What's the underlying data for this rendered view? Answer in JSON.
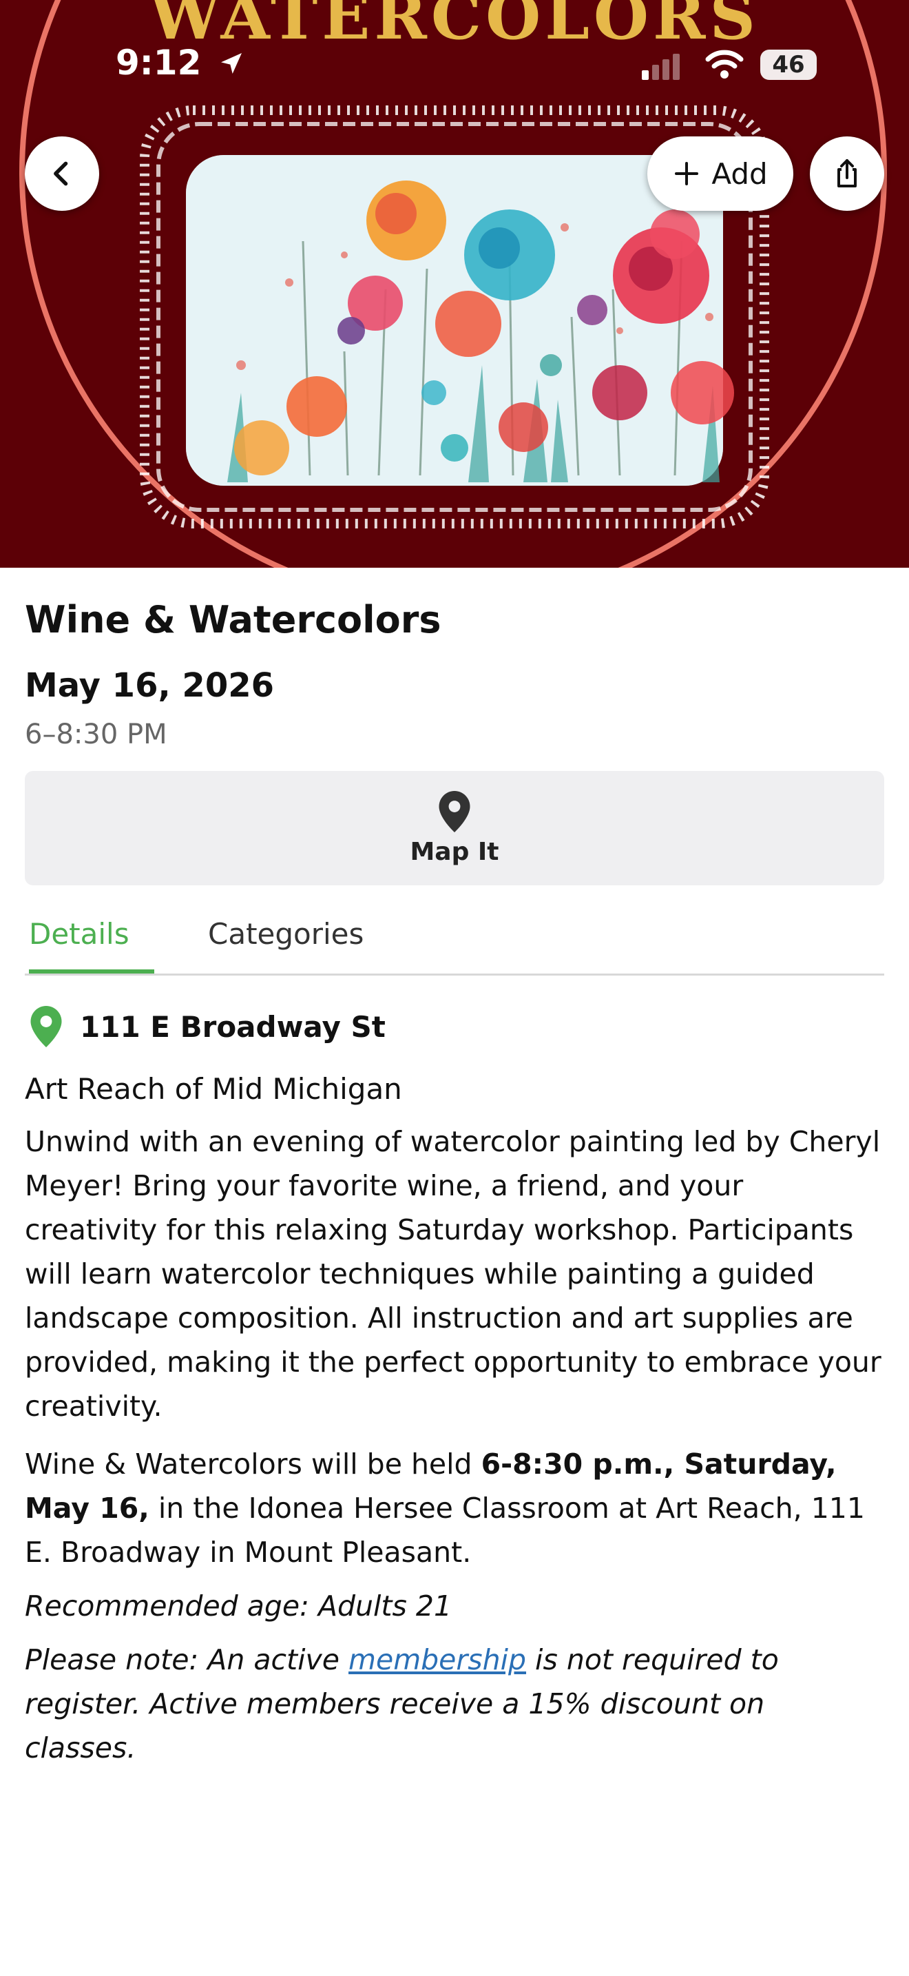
{
  "status_bar": {
    "time": "9:12",
    "battery": "46"
  },
  "hero": {
    "banner_title": "WATERCOLORS"
  },
  "actions": {
    "add_label": "Add"
  },
  "event": {
    "title": "Wine & Watercolors",
    "date": "May 16, 2026",
    "time": "6–8:30 PM",
    "map_label": "Map It"
  },
  "tabs": [
    {
      "label": "Details",
      "active": true
    },
    {
      "label": "Categories",
      "active": false
    }
  ],
  "details": {
    "address": "111 E Broadway St",
    "organization": "Art Reach of Mid Michigan",
    "description": "Unwind with an evening of watercolor painting led by Cheryl Meyer! Bring your favorite wine, a friend, and your creativity for this relaxing Saturday workshop. Participants will learn watercolor techniques while painting a guided landscape composition. All instruction and art supplies are provided, making it the perfect opportunity to embrace your creativity.",
    "schedule_prefix": "Wine & Watercolors will be held ",
    "schedule_bold": "6-8:30 p.m., Saturday, May 16,",
    "schedule_suffix": " in the Idonea Hersee Classroom at Art Reach, 111 E. Broadway in Mount Pleasant.",
    "age_note": "Recommended age: Adults 21",
    "note_prefix": "Please note: An active ",
    "note_link": "membership",
    "note_suffix": " is not required to register. Active members receive a 15% discount on classes."
  },
  "colors": {
    "hero_background": "#5c0006",
    "accent_green": "#4caf50",
    "link_blue": "#2a6fb6"
  }
}
